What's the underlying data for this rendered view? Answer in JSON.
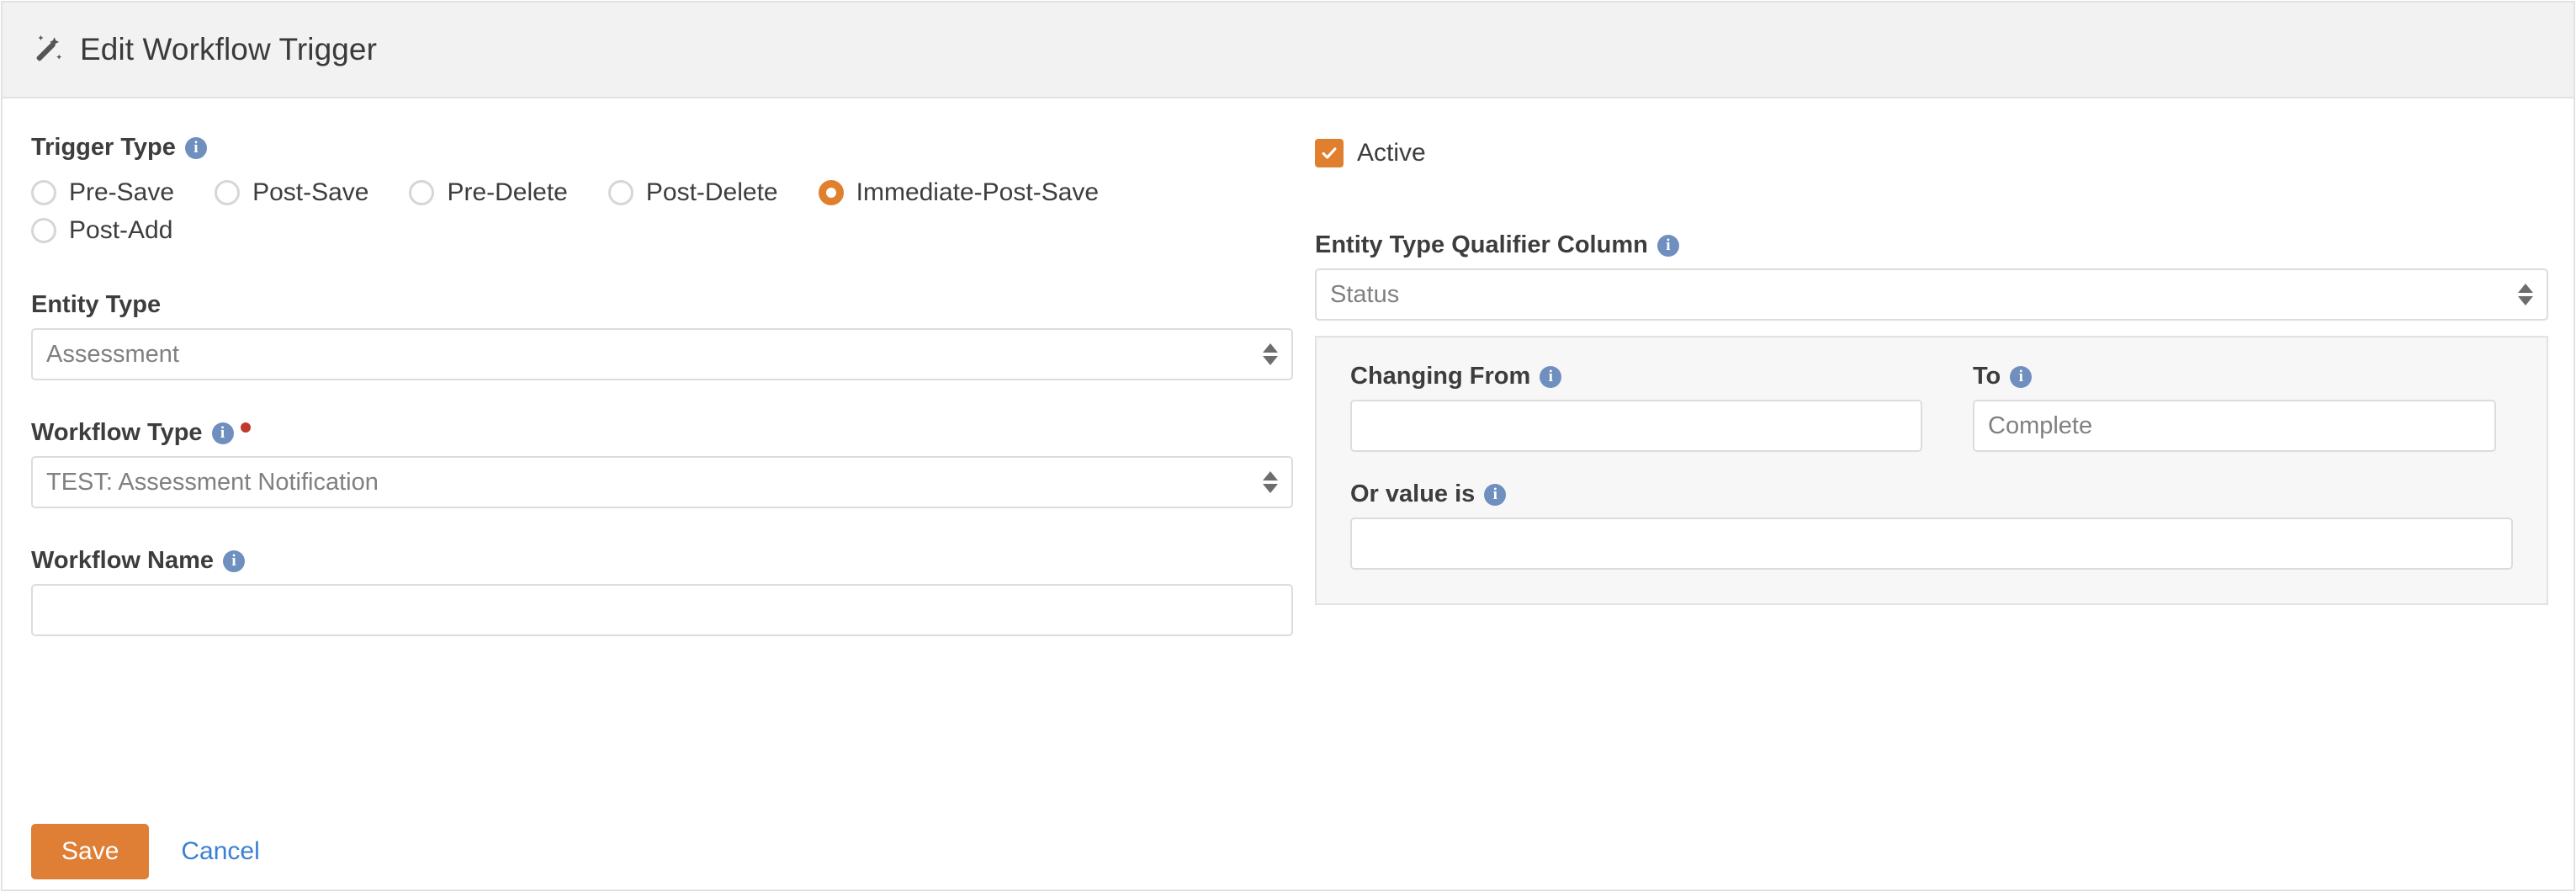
{
  "header": {
    "icon": "magic-wand-icon",
    "title": "Edit Workflow Trigger"
  },
  "colors": {
    "accent": "#e0802f",
    "save_button": "#de7f35",
    "link": "#3b7fd4",
    "info_icon": "#6f8fbf",
    "required_dot": "#c0392b",
    "panel_bg": "#f7f7f7",
    "header_bg": "#f2f2f2"
  },
  "trigger_type": {
    "label": "Trigger Type",
    "info_icon": "info-icon",
    "options": [
      {
        "label": "Pre-Save",
        "checked": false
      },
      {
        "label": "Post-Save",
        "checked": false
      },
      {
        "label": "Pre-Delete",
        "checked": false
      },
      {
        "label": "Post-Delete",
        "checked": false
      },
      {
        "label": "Immediate-Post-Save",
        "checked": true
      },
      {
        "label": "Post-Add",
        "checked": false
      }
    ],
    "selected": "Immediate-Post-Save"
  },
  "active": {
    "label": "Active",
    "checked": true,
    "check_glyph": "check-icon"
  },
  "entity_type": {
    "label": "Entity Type",
    "value": "Assessment"
  },
  "workflow_type": {
    "label": "Workflow Type",
    "info_icon": "info-icon",
    "required": true,
    "value": "TEST: Assessment Notification"
  },
  "workflow_name": {
    "label": "Workflow Name",
    "info_icon": "info-icon",
    "value": "",
    "placeholder": ""
  },
  "entity_type_qualifier_column": {
    "label": "Entity Type Qualifier Column",
    "info_icon": "info-icon",
    "value": "Status"
  },
  "qualifier_panel": {
    "changing_from": {
      "label": "Changing From",
      "info_icon": "info-icon",
      "value": "",
      "placeholder": ""
    },
    "to": {
      "label": "To",
      "info_icon": "info-icon",
      "value": "Complete",
      "placeholder": ""
    },
    "or_value_is": {
      "label": "Or value is",
      "info_icon": "info-icon",
      "value": "",
      "placeholder": ""
    }
  },
  "actions": {
    "save_label": "Save",
    "cancel_label": "Cancel"
  }
}
